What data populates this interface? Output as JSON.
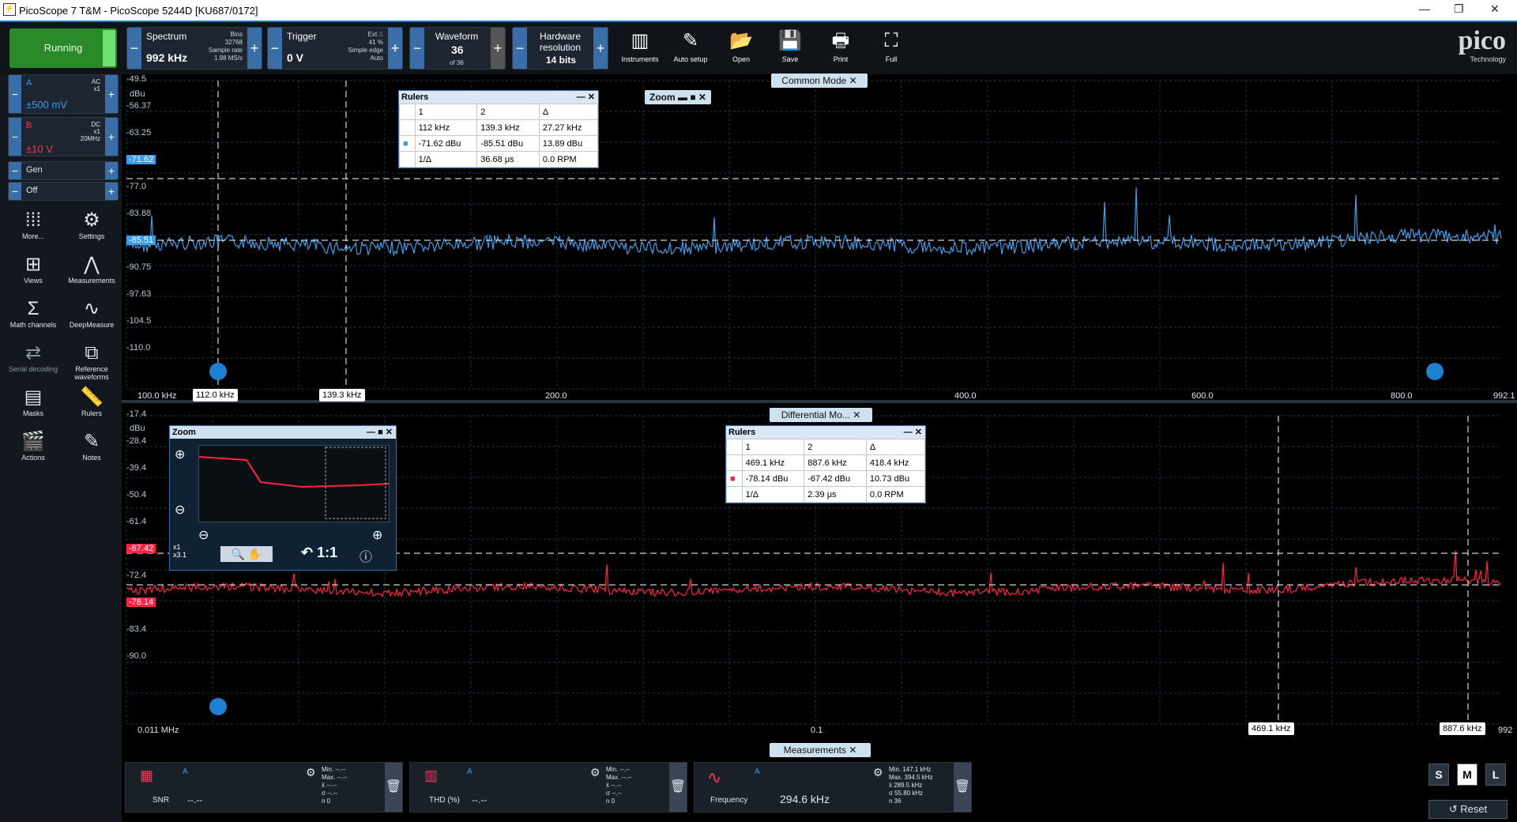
{
  "window": {
    "title": "PicoScope 7 T&M  - PicoScope 5244D [KU687/0172]"
  },
  "run": {
    "label": "Running"
  },
  "toolbar": {
    "spectrum": {
      "label": "Spectrum",
      "value": "992 kHz",
      "bins_label": "Bins",
      "bins": "32768",
      "sr_label": "Sample rate",
      "sr": "1.98 MS/s"
    },
    "trigger": {
      "label": "Trigger",
      "value": "0 V",
      "source": "Ext",
      "percent": "41 %",
      "mode": "Simple edge",
      "auto": "Auto"
    },
    "waveform": {
      "label": "Waveform",
      "value": "36",
      "of": "of 36"
    },
    "hwres": {
      "label": "Hardware resolution",
      "value": "14 bits"
    },
    "buttons": [
      "Instruments",
      "Auto setup",
      "Open",
      "Save",
      "Print",
      "Full"
    ]
  },
  "logo": {
    "name": "pico",
    "sub": "Technology"
  },
  "channels": [
    {
      "name": "A",
      "coupling": "AC",
      "probe": "x1",
      "range": "±500 mV",
      "color": "#3c9ee8"
    },
    {
      "name": "B",
      "coupling": "DC",
      "probe": "x1",
      "bw": "20MHz",
      "range": "±10 V",
      "color": "#ff3355"
    },
    {
      "name": "Gen"
    },
    {
      "name": "Off"
    }
  ],
  "sidebar": [
    "More...",
    "Settings",
    "Views",
    "Measurements",
    "Math channels",
    "DeepMeasure",
    "Serial decoding",
    "Reference waveforms",
    "Masks",
    "Rulers",
    "Actions",
    "Notes"
  ],
  "view1": {
    "tab": "Common Mode",
    "unit": "dBu",
    "yticks": [
      "-49.5",
      "-56.37",
      "-63.25",
      "-71.62",
      "-77.0",
      "-83.88",
      "-85.51",
      "-90.75",
      "-97.63",
      "-104.5",
      "-110.0"
    ],
    "xticks": [
      "100.0 kHz",
      "200.0",
      "400.0",
      "600.0",
      "800.0",
      "992.1"
    ],
    "markers": [
      "112.0 kHz",
      "139.3 kHz"
    ],
    "rulers": {
      "title": "Rulers",
      "h": [
        "1",
        "2",
        "Δ"
      ],
      "r1": [
        "112 kHz",
        "139.3 kHz",
        "27.27 kHz"
      ],
      "r2": [
        "-71.62 dBu",
        "-85.51 dBu",
        "13.89 dBu"
      ],
      "r3": [
        "1/Δ",
        "36.68 μs",
        "0.0 RPM"
      ]
    },
    "zoom_label": "Zoom"
  },
  "view2": {
    "tab": "Differential Mo...",
    "unit": "dBu",
    "yticks": [
      "-17.4",
      "-28.4",
      "-39.4",
      "-50.4",
      "-61.4",
      "-67.42",
      "-72.4",
      "-78.14",
      "-83.4",
      "-90.0"
    ],
    "xticks": [
      "0.011 MHz",
      "0.1",
      "992"
    ],
    "markers": [
      "469.1 kHz",
      "887.6 kHz"
    ],
    "rulers": {
      "title": "Rulers",
      "h": [
        "1",
        "2",
        "Δ"
      ],
      "r1": [
        "469.1 kHz",
        "887.6 kHz",
        "418.4 kHz"
      ],
      "r2": [
        "-78.14 dBu",
        "-67.42 dBu",
        "10.73 dBu"
      ],
      "r3": [
        "1/Δ",
        "2.39 μs",
        "0.0 RPM"
      ]
    },
    "zoom": {
      "title": "Zoom",
      "x1": "x1",
      "x3": "x3.1",
      "oneone": "1:1"
    }
  },
  "measurements": {
    "tab": "Measurements",
    "items": [
      {
        "name": "SNR",
        "channel": "A",
        "value": "--.--",
        "stats": [
          "Min. --.--",
          "Max. --.--",
          "x̄ --.--",
          "σ --.--",
          "n 0"
        ]
      },
      {
        "name": "THD (%)",
        "channel": "A",
        "value": "--.--",
        "stats": [
          "Min. --.--",
          "Max. --.--",
          "x̄ --.--",
          "σ --.--",
          "n 0"
        ]
      },
      {
        "name": "Frequency",
        "channel": "A",
        "value": "294.6 kHz",
        "stats": [
          "Min. 147.1 kHz",
          "Max. 394.5 kHz",
          "x̄ 289.5 kHz",
          "σ 55.80 kHz",
          "n 36"
        ]
      }
    ]
  },
  "size": {
    "s": "S",
    "m": "M",
    "l": "L"
  },
  "reset": "Reset"
}
